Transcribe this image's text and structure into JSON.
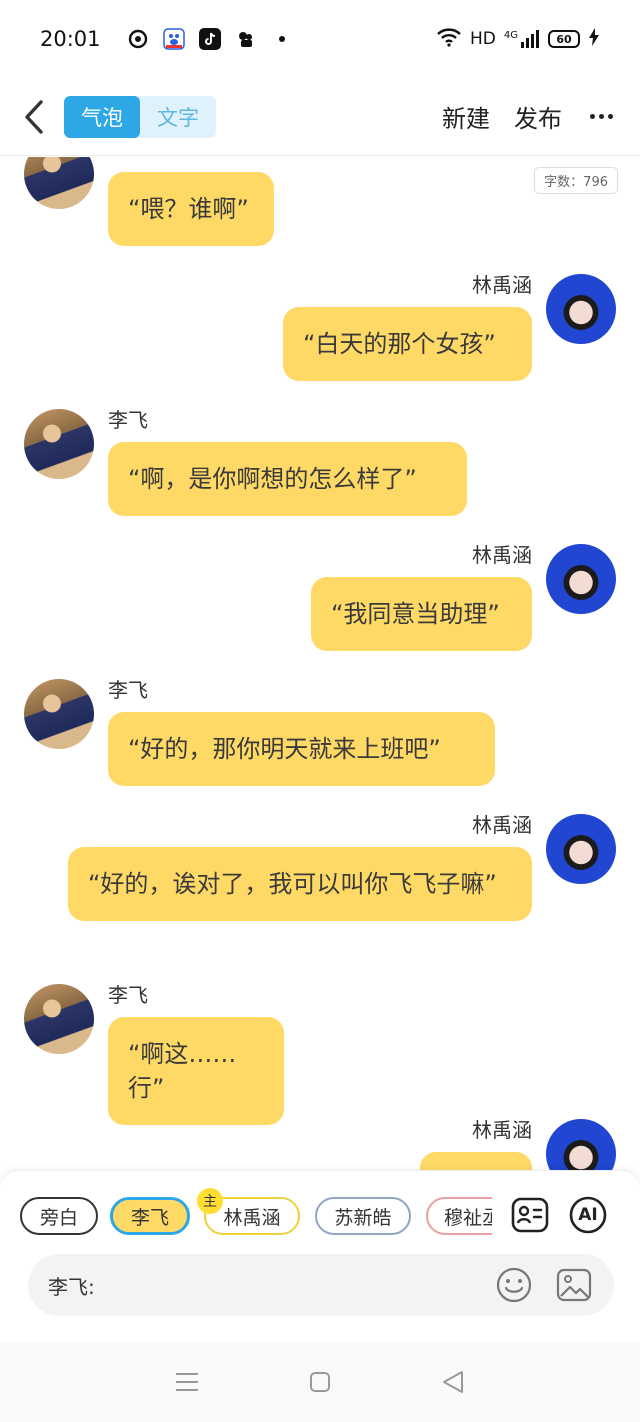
{
  "status": {
    "time": "20:01",
    "network": "HD",
    "signal": "4G",
    "battery": "60"
  },
  "header": {
    "tabs": [
      "气泡",
      "文字"
    ],
    "new_label": "新建",
    "publish_label": "发布"
  },
  "word_count": "字数：796",
  "messages": [
    {
      "speaker": "",
      "side": "left",
      "text": "“喂？谁啊”"
    },
    {
      "speaker": "林禹涵",
      "side": "right",
      "text": "“白天的那个女孩”"
    },
    {
      "speaker": "李飞",
      "side": "left",
      "text": "“啊，是你啊想的怎么样了”"
    },
    {
      "speaker": "林禹涵",
      "side": "right",
      "text": "“我同意当助理”"
    },
    {
      "speaker": "李飞",
      "side": "left",
      "text": "“好的，那你明天就来上班吧”"
    },
    {
      "speaker": "林禹涵",
      "side": "right",
      "text": "“好的，诶对了，我可以叫你飞飞子嘛”"
    },
    {
      "speaker": "李飞",
      "side": "left",
      "text": "“啊这……行”"
    },
    {
      "speaker": "林禹涵",
      "side": "right",
      "text": ""
    }
  ],
  "characters": [
    "旁白",
    "李飞",
    "林禹涵",
    "苏新皓",
    "穆祉丞"
  ],
  "lead_badge": "主",
  "ai_label": "AI",
  "input": {
    "label": "李飞:",
    "value": ""
  },
  "icons": [
    "back-arrow-icon",
    "more-dots-icon",
    "contact-card-icon",
    "ai-icon",
    "emoji-icon",
    "image-icon",
    "menu-icon",
    "home-icon",
    "back-icon"
  ]
}
